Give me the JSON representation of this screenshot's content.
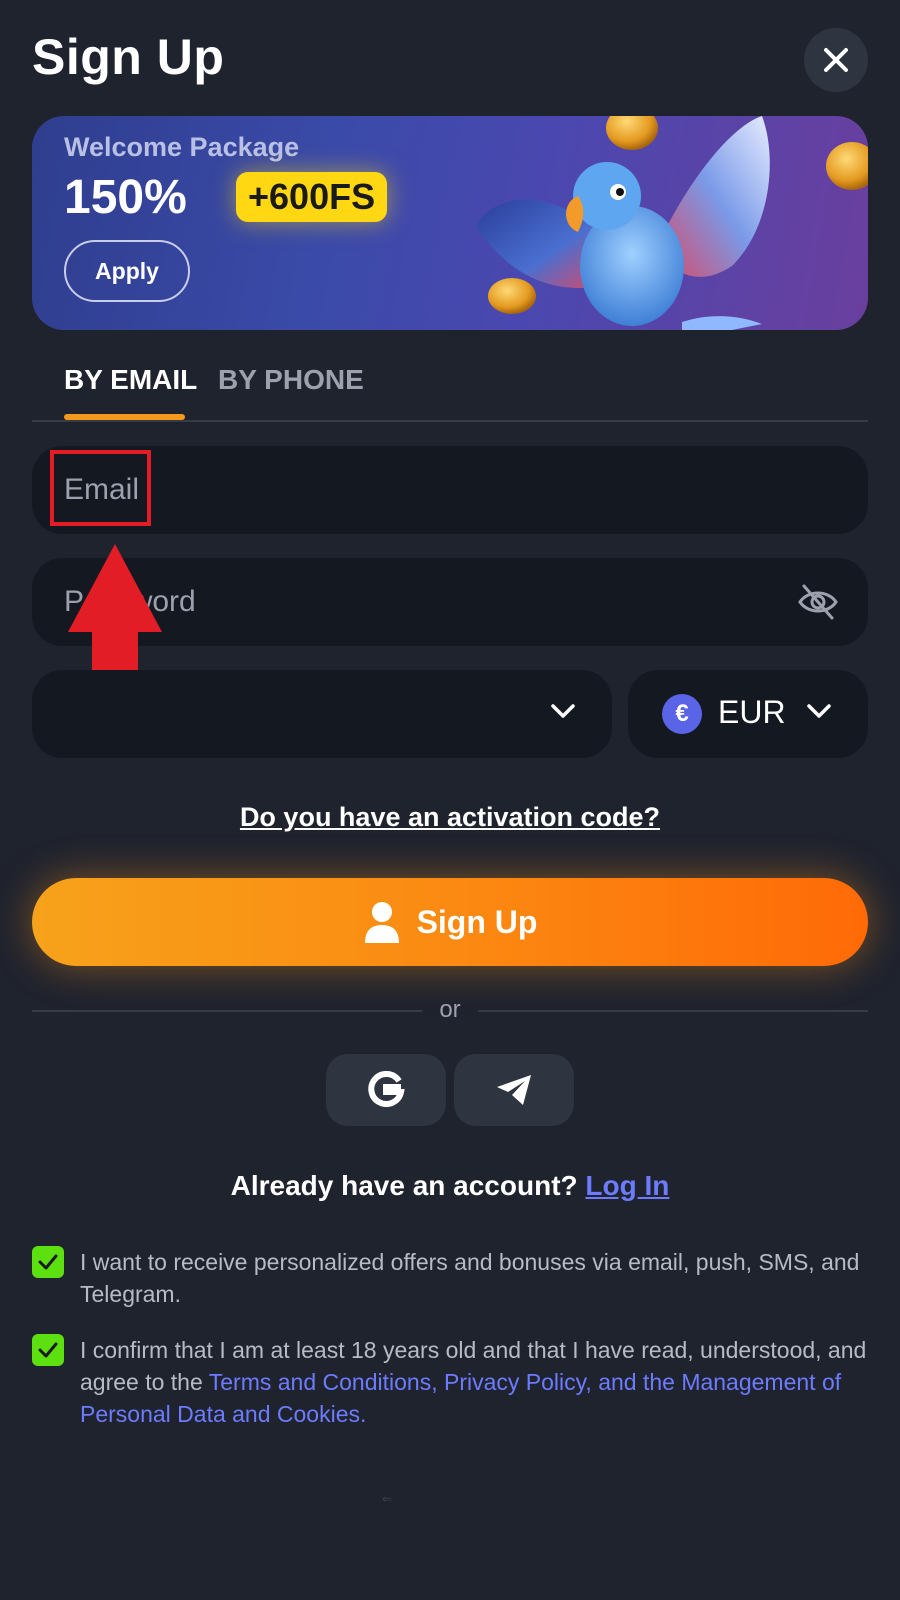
{
  "header": {
    "title": "Sign Up",
    "close_icon": "close-icon"
  },
  "banner": {
    "welcome": "Welcome Package",
    "percent": "150%",
    "free_spins": "+600FS",
    "apply_label": "Apply"
  },
  "tabs": [
    {
      "label": "BY EMAIL",
      "active": true
    },
    {
      "label": "BY PHONE",
      "active": false
    }
  ],
  "form": {
    "email_placeholder": "Email",
    "password_placeholder": "Password",
    "country_value": "",
    "currency_symbol": "€",
    "currency_label": "EUR"
  },
  "activation_label": "Do you have an activation code?",
  "signup_label": "Sign Up",
  "divider_label": "or",
  "login": {
    "prompt": "Already have an account?",
    "link": "Log In"
  },
  "consents": {
    "offers": "I want to receive personalized offers and bonuses via email, push, SMS, and Telegram.",
    "age_prefix": "I confirm that I am at least 18 years old and that I have read, understood, and agree to the ",
    "age_link": "Terms and Conditions, Privacy Policy, and the Management of Personal Data and Cookies."
  },
  "colors": {
    "accent_orange": "#f7a21b",
    "link_blue": "#6c7bff",
    "check_green": "#5ce00f",
    "highlight_red": "#e31d26"
  }
}
